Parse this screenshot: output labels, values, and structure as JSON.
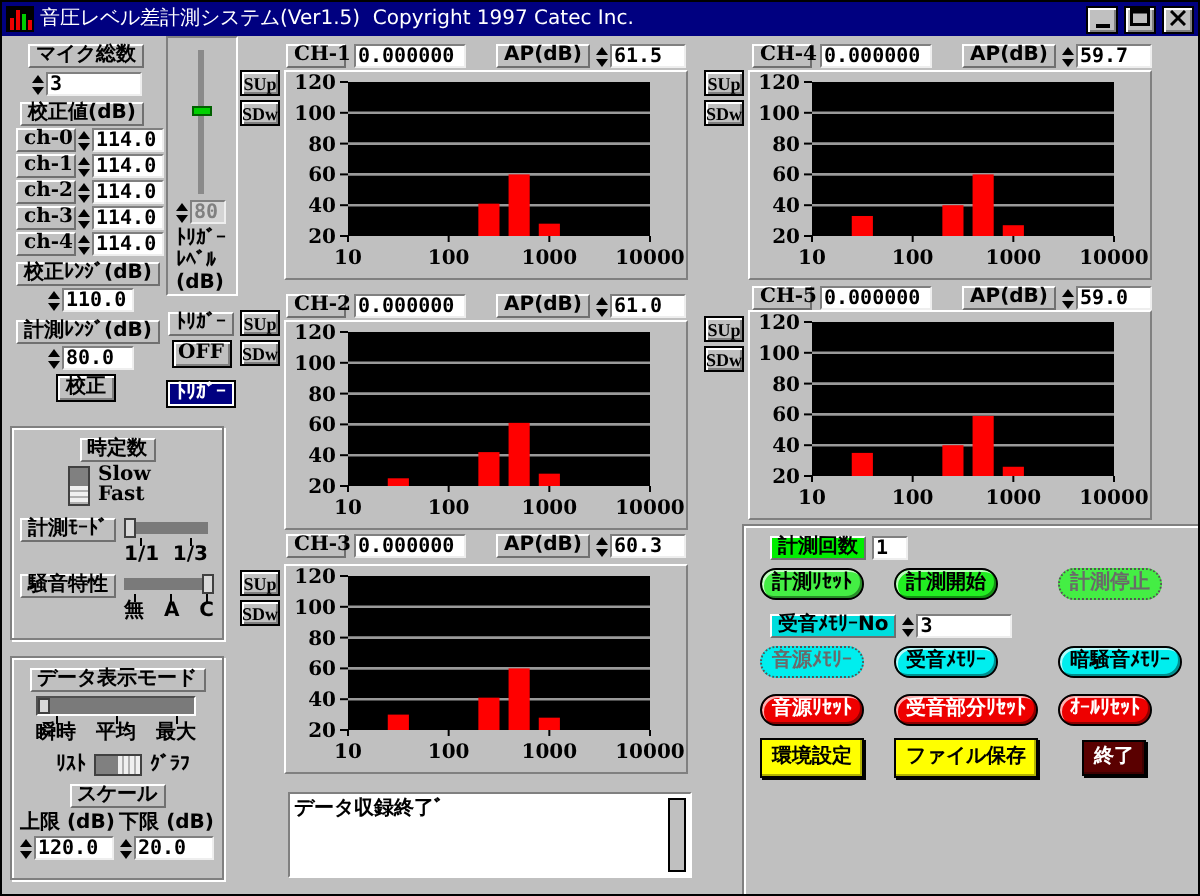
{
  "window": {
    "title": "音圧レベル差計測システム(Ver1.5)  Copyright 1997 Catec Inc."
  },
  "mic_count": {
    "label": "マイク総数",
    "value": "3"
  },
  "calibration": {
    "label": "校正値(dB)",
    "channels": [
      {
        "name": "ch-0",
        "value": "114.0"
      },
      {
        "name": "ch-1",
        "value": "114.0"
      },
      {
        "name": "ch-2",
        "value": "114.0"
      },
      {
        "name": "ch-3",
        "value": "114.0"
      },
      {
        "name": "ch-4",
        "value": "114.0"
      }
    ]
  },
  "ranges": [
    {
      "label": "校正ﾚﾝｼﾞ(dB)",
      "value": "110.0"
    },
    {
      "label": "計測ﾚﾝｼﾞ(dB)",
      "value": "80.0"
    }
  ],
  "calibrate_button": "校正",
  "trigger": {
    "level": 0.6,
    "value": "80",
    "value_disabled": true,
    "label_lines": [
      "ﾄﾘｶﾞｰ",
      "ﾚﾍﾞﾙ",
      "(dB)"
    ],
    "label": "ﾄﾘｶﾞｰ",
    "off_button": "OFF",
    "trigger_button": {
      "label": "ﾄﾘｶﾞｰ",
      "selected": true
    }
  },
  "time_constant": {
    "label": "時定数",
    "options": [
      "Slow",
      "Fast"
    ],
    "switch_on": true
  },
  "sliders": [
    {
      "label": "計測ﾓｰﾄﾞ",
      "level": 0,
      "ticks": [
        "1/1",
        "1/3"
      ]
    },
    {
      "label": "騒音特性",
      "level": 1,
      "ticks": [
        "無",
        "A",
        "C"
      ]
    }
  ],
  "display_mode": {
    "label": "データ表示モード",
    "level": 0,
    "ticks": [
      "瞬時",
      "平均",
      "最大"
    ],
    "options": [
      "ﾘｽﾄ",
      "ｸﾞﾗﾌ"
    ],
    "switch_on": true,
    "scale_label": "スケール",
    "limits": [
      {
        "label": "上限 (dB)",
        "value": "120.0"
      },
      {
        "label": "下限 (dB)",
        "value": "20.0"
      }
    ]
  },
  "channels": [
    {
      "name": "CH-1",
      "value": "0.000000",
      "ap_label": "AP(dB)",
      "ap": "61.5",
      "buttons": [
        "SUp",
        "SDw"
      ],
      "chart_data": {
        "type": "bar",
        "categories": [
          "10",
          null,
          null,
          null,
          null,
          null,
          null,
          null,
          null,
          null,
          "100",
          null,
          null,
          null,
          null,
          null,
          null,
          null,
          null,
          null,
          "1000",
          null,
          null,
          null,
          null,
          null,
          null,
          null,
          null,
          null,
          "10000"
        ],
        "values": [
          null,
          null,
          null,
          null,
          null,
          null,
          null,
          null,
          null,
          null,
          null,
          null,
          null,
          null,
          41,
          null,
          null,
          60,
          null,
          null,
          28,
          null,
          null,
          null,
          null,
          null,
          null,
          null,
          null,
          null,
          null
        ],
        "ylim": [
          20,
          120
        ],
        "yticks": [
          20,
          40,
          60,
          80,
          100,
          120
        ],
        "grid": true
      }
    },
    {
      "name": "CH-2",
      "value": "0.000000",
      "ap_label": "AP(dB)",
      "ap": "61.0",
      "buttons": [
        "SUp",
        "SDw"
      ],
      "chart_data": {
        "type": "bar",
        "categories": [
          "10",
          null,
          null,
          null,
          null,
          null,
          null,
          null,
          null,
          null,
          "100",
          null,
          null,
          null,
          null,
          null,
          null,
          null,
          null,
          null,
          "1000",
          null,
          null,
          null,
          null,
          null,
          null,
          null,
          null,
          null,
          "10000"
        ],
        "values": [
          null,
          null,
          null,
          null,
          null,
          25,
          null,
          null,
          null,
          null,
          null,
          null,
          null,
          null,
          42,
          null,
          null,
          61,
          null,
          null,
          28,
          null,
          null,
          null,
          null,
          null,
          null,
          null,
          null,
          null,
          null
        ],
        "ylim": [
          20,
          120
        ],
        "yticks": [
          20,
          40,
          60,
          80,
          100,
          120
        ],
        "grid": true
      }
    },
    {
      "name": "CH-3",
      "value": "0.000000",
      "ap_label": "AP(dB)",
      "ap": "60.3",
      "buttons": [
        "SUp",
        "SDw"
      ],
      "chart_data": {
        "type": "bar",
        "categories": [
          "10",
          null,
          null,
          null,
          null,
          null,
          null,
          null,
          null,
          null,
          "100",
          null,
          null,
          null,
          null,
          null,
          null,
          null,
          null,
          null,
          "1000",
          null,
          null,
          null,
          null,
          null,
          null,
          null,
          null,
          null,
          "10000"
        ],
        "values": [
          null,
          null,
          null,
          null,
          null,
          30,
          null,
          null,
          null,
          null,
          null,
          null,
          null,
          null,
          41,
          null,
          null,
          60,
          null,
          null,
          28,
          null,
          null,
          null,
          null,
          null,
          null,
          null,
          null,
          null,
          null
        ],
        "ylim": [
          20,
          120
        ],
        "yticks": [
          20,
          40,
          60,
          80,
          100,
          120
        ],
        "grid": true
      }
    },
    {
      "name": "CH-4",
      "value": "0.000000",
      "ap_label": "AP(dB)",
      "ap": "59.7",
      "buttons": [
        "SUp",
        "SDw"
      ],
      "chart_data": {
        "type": "bar",
        "categories": [
          "10",
          null,
          null,
          null,
          null,
          null,
          null,
          null,
          null,
          null,
          "100",
          null,
          null,
          null,
          null,
          null,
          null,
          null,
          null,
          null,
          "1000",
          null,
          null,
          null,
          null,
          null,
          null,
          null,
          null,
          null,
          "10000"
        ],
        "values": [
          null,
          null,
          null,
          null,
          null,
          33,
          null,
          null,
          null,
          null,
          null,
          null,
          null,
          null,
          40,
          null,
          null,
          60,
          null,
          null,
          27,
          null,
          null,
          null,
          null,
          null,
          null,
          null,
          null,
          null,
          null
        ],
        "ylim": [
          20,
          120
        ],
        "yticks": [
          20,
          40,
          60,
          80,
          100,
          120
        ],
        "grid": true
      }
    },
    {
      "name": "CH-5",
      "value": "0.000000",
      "ap_label": "AP(dB)",
      "ap": "59.0",
      "buttons": [
        "SUp",
        "SDw"
      ],
      "chart_data": {
        "type": "bar",
        "categories": [
          "10",
          null,
          null,
          null,
          null,
          null,
          null,
          null,
          null,
          null,
          "100",
          null,
          null,
          null,
          null,
          null,
          null,
          null,
          null,
          null,
          "1000",
          null,
          null,
          null,
          null,
          null,
          null,
          null,
          null,
          null,
          "10000"
        ],
        "values": [
          null,
          null,
          null,
          null,
          null,
          35,
          null,
          null,
          null,
          null,
          null,
          null,
          null,
          null,
          40,
          null,
          null,
          59,
          null,
          null,
          26,
          null,
          null,
          null,
          null,
          null,
          null,
          null,
          null,
          null,
          null
        ],
        "ylim": [
          20,
          120
        ],
        "yticks": [
          20,
          40,
          60,
          80,
          100,
          120
        ],
        "grid": true
      }
    }
  ],
  "status": "データ収録終了ﾞ",
  "controls": [
    {
      "kind": "field",
      "label": "計測回数",
      "value": "1",
      "color": "#00ee00",
      "spin": false
    },
    {
      "kind": "buttons",
      "buttons": [
        {
          "label": "計測ﾘｾｯﾄ",
          "color": "#44ee44",
          "kind": "pill",
          "disabled": false
        },
        {
          "label": "計測開始",
          "color": "#22ee22",
          "kind": "pill",
          "disabled": false
        },
        {
          "label": "計測停止",
          "color": "#44ee44",
          "kind": "pill",
          "disabled": true
        }
      ]
    },
    {
      "kind": "field",
      "label": "受音ﾒﾓﾘｰNo",
      "value": "3",
      "color": "#00dddd",
      "spin": true
    },
    {
      "kind": "buttons",
      "buttons": [
        {
          "label": "音源ﾒﾓﾘｰ",
          "color": "#00eeee",
          "kind": "pill",
          "disabled": true
        },
        {
          "label": "受音ﾒﾓﾘｰ",
          "color": "#00eeee",
          "kind": "pill",
          "disabled": false
        },
        {
          "label": "暗騒音ﾒﾓﾘｰ",
          "color": "#00eeee",
          "kind": "pill",
          "disabled": false
        }
      ]
    },
    {
      "kind": "buttons",
      "buttons": [
        {
          "label": "音源ﾘｾｯﾄ",
          "color": "#ee0000",
          "kind": "pill",
          "disabled": false
        },
        {
          "label": "受音部分ﾘｾｯﾄ",
          "color": "#ee0000",
          "kind": "pill",
          "disabled": false
        },
        {
          "label": "ｵｰﾙﾘｾｯﾄ",
          "color": "#ee0000",
          "kind": "pill",
          "disabled": false
        }
      ]
    },
    {
      "kind": "buttons",
      "buttons": [
        {
          "label": "環境設定",
          "color": "#ffff00",
          "kind": "square",
          "disabled": false
        },
        {
          "label": "ファイル保存",
          "color": "#ffff00",
          "kind": "square",
          "disabled": false
        },
        {
          "label": "終了",
          "color": "#5a0000",
          "kind": "square",
          "disabled": false
        }
      ]
    }
  ]
}
